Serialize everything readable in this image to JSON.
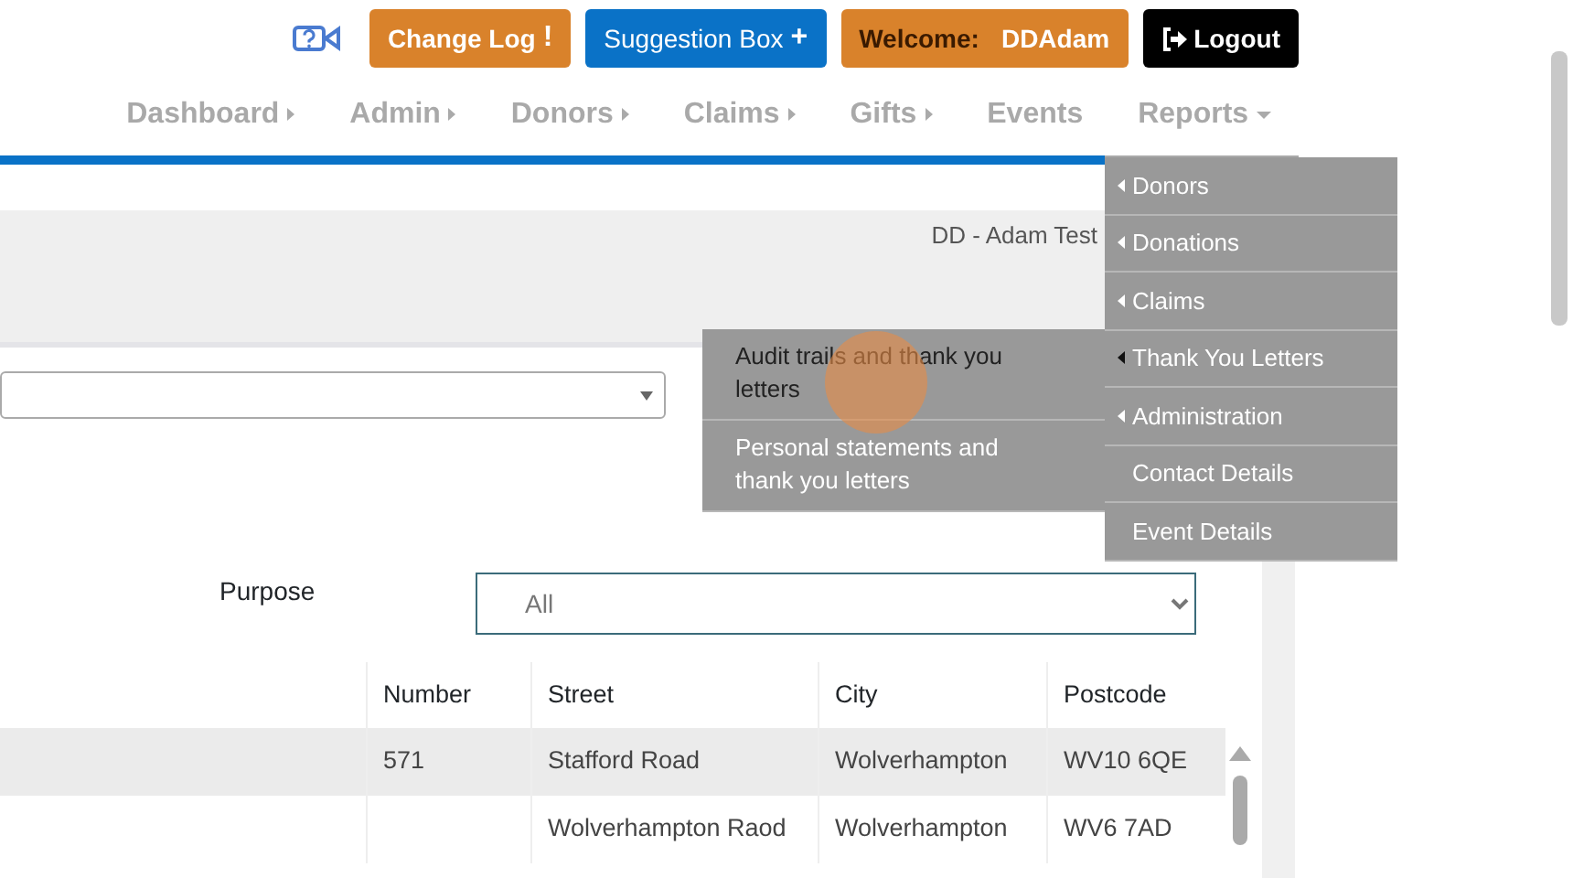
{
  "header_buttons": [
    {
      "kind": "changelog",
      "label": "Change Log",
      "icon": "!"
    },
    {
      "kind": "suggestion",
      "label": "Suggestion Box",
      "icon": "+"
    },
    {
      "kind": "welcome",
      "label": "Welcome:",
      "user": "DDAdam"
    },
    {
      "kind": "logout",
      "label": "Logout"
    }
  ],
  "nav": [
    {
      "label": "Dashboard",
      "kind": "submenu"
    },
    {
      "label": "Admin",
      "kind": "submenu"
    },
    {
      "label": "Donors",
      "kind": "submenu"
    },
    {
      "label": "Claims",
      "kind": "submenu"
    },
    {
      "label": "Gifts",
      "kind": "submenu"
    },
    {
      "label": "Events",
      "kind": "link"
    },
    {
      "label": "Reports",
      "kind": "dropdown"
    }
  ],
  "organisation": "DD - Adam Test",
  "reports_menu": [
    {
      "label": "Donors",
      "submenu": true,
      "selected": false
    },
    {
      "label": "Donations",
      "submenu": true,
      "selected": false
    },
    {
      "label": "Claims",
      "submenu": true,
      "selected": false
    },
    {
      "label": "Thank You Letters",
      "submenu": true,
      "selected": true
    },
    {
      "label": "Administration",
      "submenu": true,
      "selected": false
    },
    {
      "label": "Contact Details",
      "submenu": false,
      "selected": false
    },
    {
      "label": "Event Details",
      "submenu": false,
      "selected": false
    }
  ],
  "submenu": [
    {
      "label": "Audit trails and thank you letters",
      "selected": true
    },
    {
      "label": "Personal statements and thank you letters",
      "selected": false
    }
  ],
  "purpose": {
    "label": "Purpose",
    "value": "All"
  },
  "table": {
    "columns": [
      "Number",
      "Street",
      "City",
      "Postcode"
    ],
    "rows": [
      {
        "cells": [
          "571",
          "Stafford Road",
          "Wolverhampton",
          "WV10 6QE"
        ],
        "selected": true
      },
      {
        "cells": [
          "",
          "Wolverhampton Raod",
          "Wolverhampton",
          "WV6 7AD"
        ],
        "selected": false
      }
    ]
  }
}
